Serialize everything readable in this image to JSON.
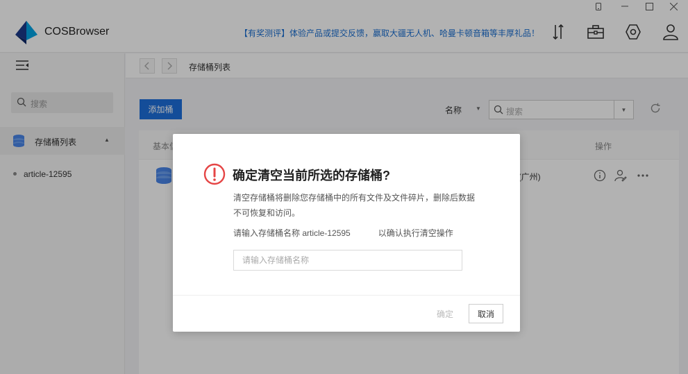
{
  "window": {
    "controls": [
      "device-icon",
      "minimize-icon",
      "maximize-icon",
      "close-icon"
    ]
  },
  "header": {
    "app_name": "COSBrowser",
    "promo": "【有奖测评】体验产品或提交反馈，赢取大疆无人机、哈曼卡顿音箱等丰厚礼品！",
    "icons": [
      "transfer-icon",
      "toolbox-icon",
      "settings-icon",
      "user-icon"
    ]
  },
  "sidebar": {
    "search_placeholder": "搜索",
    "section_label": "存储桶列表",
    "items": [
      {
        "label": "article-12595"
      }
    ]
  },
  "breadcrumb": {
    "current": "存储桶列表"
  },
  "toolbar": {
    "add_label": "添加桶",
    "sort_label": "名称",
    "search_placeholder": "搜索"
  },
  "table": {
    "headers": [
      "基本信",
      "操作"
    ],
    "row": {
      "region": "u(广州)"
    }
  },
  "dialog": {
    "title": "确定清空当前所选的存储桶?",
    "description": "清空存储桶将删除您存储桶中的所有文件及文件碎片，删除后数据不可恢复和访问。",
    "confirm_prefix": "请输入存储桶名称 article-12595",
    "confirm_suffix": "以确认执行清空操作",
    "input_placeholder": "请输入存储桶名称",
    "ok_label": "确定",
    "cancel_label": "取消"
  },
  "colors": {
    "primary": "#1e6fdc",
    "warning": "#e54545",
    "promo": "#1b6fd1"
  }
}
